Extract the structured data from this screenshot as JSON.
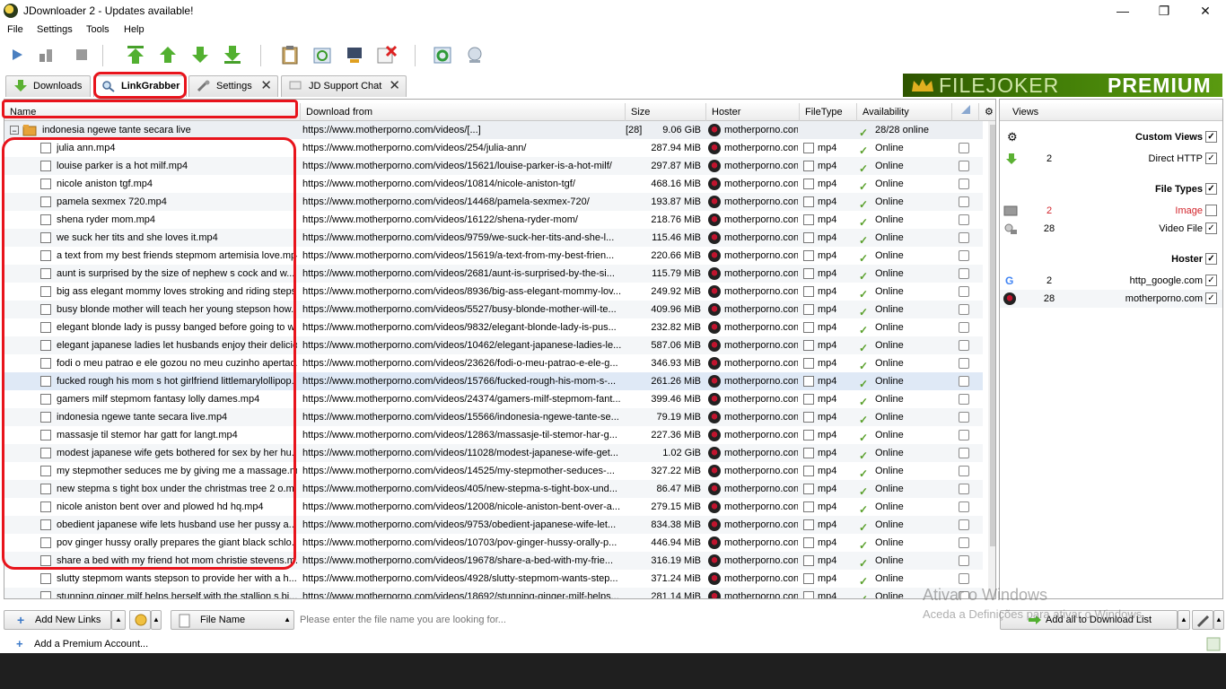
{
  "window": {
    "title": "JDownloader 2 - Updates available!",
    "minimize": "—",
    "restore": "❐",
    "close": "✕"
  },
  "menu": {
    "file": "File",
    "settings": "Settings",
    "tools": "Tools",
    "help": "Help"
  },
  "toolbar": {
    "icons": [
      "play-icon",
      "pause-icon",
      "stop-icon",
      "move-top-icon",
      "move-up-icon",
      "move-down-icon",
      "move-bottom-icon",
      "clipboard-icon",
      "refresh-icon",
      "reconnect-icon",
      "remove-offline-icon",
      "update-icon",
      "premium-globe-icon"
    ]
  },
  "tabs": [
    {
      "label": "Downloads",
      "closable": false
    },
    {
      "label": "LinkGrabber",
      "closable": false,
      "active": true
    },
    {
      "label": "Settings",
      "closable": true
    },
    {
      "label": "JD Support Chat",
      "closable": true
    }
  ],
  "banner": {
    "part1": "FILEJOKER",
    "part2": "PREMIUM"
  },
  "table": {
    "columns": {
      "name": "Name",
      "from": "Download from",
      "size": "Size",
      "hoster": "Hoster",
      "filetype": "FileType",
      "availability": "Availability"
    },
    "package": {
      "name": "indonesia ngewe tante secara live",
      "from": "https://www.motherporno.com/videos/[...]",
      "count": "[28]",
      "size": "9.06 GiB",
      "hoster": "motherporno.con",
      "availability": "28/28 online",
      "expander": "−"
    },
    "rows": [
      {
        "name": "julia ann.mp4",
        "from": "https://www.motherporno.com/videos/254/julia-ann/",
        "size": "287.94 MiB"
      },
      {
        "name": "louise parker is a hot milf.mp4",
        "from": "https://www.motherporno.com/videos/15621/louise-parker-is-a-hot-milf/",
        "size": "297.87 MiB"
      },
      {
        "name": "nicole aniston tgf.mp4",
        "from": "https://www.motherporno.com/videos/10814/nicole-aniston-tgf/",
        "size": "468.16 MiB"
      },
      {
        "name": "pamela sexmex 720.mp4",
        "from": "https://www.motherporno.com/videos/14468/pamela-sexmex-720/",
        "size": "193.87 MiB"
      },
      {
        "name": "shena ryder mom.mp4",
        "from": "https://www.motherporno.com/videos/16122/shena-ryder-mom/",
        "size": "218.76 MiB"
      },
      {
        "name": "we suck her tits and she loves it.mp4",
        "from": "https://www.motherporno.com/videos/9759/we-suck-her-tits-and-she-l...",
        "size": "115.46 MiB"
      },
      {
        "name": "a text from my best friends stepmom artemisia love.mp4",
        "from": "https://www.motherporno.com/videos/15619/a-text-from-my-best-frien...",
        "size": "220.66 MiB"
      },
      {
        "name": "aunt is surprised by the size of nephew s cock and w...",
        "from": "https://www.motherporno.com/videos/2681/aunt-is-surprised-by-the-si...",
        "size": "115.79 MiB"
      },
      {
        "name": "big ass elegant mommy loves stroking and riding steps...",
        "from": "https://www.motherporno.com/videos/8936/big-ass-elegant-mommy-lov...",
        "size": "249.92 MiB"
      },
      {
        "name": "busy blonde mother will teach her young stepson how...",
        "from": "https://www.motherporno.com/videos/5527/busy-blonde-mother-will-te...",
        "size": "409.96 MiB"
      },
      {
        "name": "elegant blonde lady is pussy banged before going to w...",
        "from": "https://www.motherporno.com/videos/9832/elegant-blonde-lady-is-pus...",
        "size": "232.82 MiB"
      },
      {
        "name": "elegant japanese ladies let husbands enjoy their delicio...",
        "from": "https://www.motherporno.com/videos/10462/elegant-japanese-ladies-le...",
        "size": "587.06 MiB"
      },
      {
        "name": "fodi o meu patrao e ele gozou no meu cuzinho apertad...",
        "from": "https://www.motherporno.com/videos/23626/fodi-o-meu-patrao-e-ele-g...",
        "size": "346.93 MiB"
      },
      {
        "name": "fucked rough his mom s hot girlfriend littlemarylollipop...",
        "from": "https://www.motherporno.com/videos/15766/fucked-rough-his-mom-s-...",
        "size": "261.26 MiB",
        "selected": true
      },
      {
        "name": "gamers milf stepmom fantasy lolly dames.mp4",
        "from": "https://www.motherporno.com/videos/24374/gamers-milf-stepmom-fant...",
        "size": "399.46 MiB"
      },
      {
        "name": "indonesia ngewe tante secara live.mp4",
        "from": "https://www.motherporno.com/videos/15566/indonesia-ngewe-tante-se...",
        "size": "79.19 MiB"
      },
      {
        "name": "massasje til stemor har gatt for langt.mp4",
        "from": "https://www.motherporno.com/videos/12863/massasje-til-stemor-har-g...",
        "size": "227.36 MiB"
      },
      {
        "name": "modest japanese wife gets bothered for sex by her hu...",
        "from": "https://www.motherporno.com/videos/11028/modest-japanese-wife-get...",
        "size": "1.02 GiB"
      },
      {
        "name": "my stepmother seduces me by giving me a massage.m...",
        "from": "https://www.motherporno.com/videos/14525/my-stepmother-seduces-...",
        "size": "327.22 MiB"
      },
      {
        "name": "new stepma s tight box under the christmas tree 2 o.m...",
        "from": "https://www.motherporno.com/videos/405/new-stepma-s-tight-box-und...",
        "size": "86.47 MiB"
      },
      {
        "name": "nicole aniston bent over and plowed hd hq.mp4",
        "from": "https://www.motherporno.com/videos/12008/nicole-aniston-bent-over-a...",
        "size": "279.15 MiB"
      },
      {
        "name": "obedient japanese wife lets husband use her pussy a...",
        "from": "https://www.motherporno.com/videos/9753/obedient-japanese-wife-let...",
        "size": "834.38 MiB"
      },
      {
        "name": "pov ginger hussy orally prepares the giant black schlo...",
        "from": "https://www.motherporno.com/videos/10703/pov-ginger-hussy-orally-p...",
        "size": "446.94 MiB"
      },
      {
        "name": "share a bed with my friend hot mom christie stevens.m...",
        "from": "https://www.motherporno.com/videos/19678/share-a-bed-with-my-frie...",
        "size": "316.19 MiB"
      },
      {
        "name": "slutty stepmom wants stepson to provide her with a h...",
        "from": "https://www.motherporno.com/videos/4928/slutty-stepmom-wants-step...",
        "size": "371.24 MiB"
      },
      {
        "name": "stunning ginger milf helps herself with the stallion s bi...",
        "from": "https://www.motherporno.com/videos/18692/stunning-ginger-milf-helps...",
        "size": "281.14 MiB"
      }
    ],
    "row_hoster": "motherporno.con",
    "row_filetype": "mp4",
    "row_availability": "Online"
  },
  "views": {
    "header": "Views",
    "custom_views": "Custom Views",
    "direct_http": {
      "count": "2",
      "label": "Direct HTTP"
    },
    "file_types": "File Types",
    "image": {
      "count": "2",
      "label": "Image"
    },
    "video_file": {
      "count": "28",
      "label": "Video File"
    },
    "hoster": "Hoster",
    "http_google": {
      "count": "2",
      "label": "http_google.com"
    },
    "motherporno": {
      "count": "28",
      "label": "motherporno.com"
    },
    "checkmark": "✓"
  },
  "bottom": {
    "add_new_links": "Add New Links",
    "file_name": "File Name",
    "search_placeholder": "Please enter the file name you are looking for...",
    "add_all": "Add all to Download List"
  },
  "status": {
    "add_premium": "Add a Premium Account..."
  },
  "watermark": {
    "line1": "Ativar o Windows",
    "line2": "Aceda a Definições para ativar o Windows."
  },
  "colors": {
    "red_annotation": "#e8141c",
    "online_green": "#5aa02c",
    "image_red": "#d2232a"
  }
}
